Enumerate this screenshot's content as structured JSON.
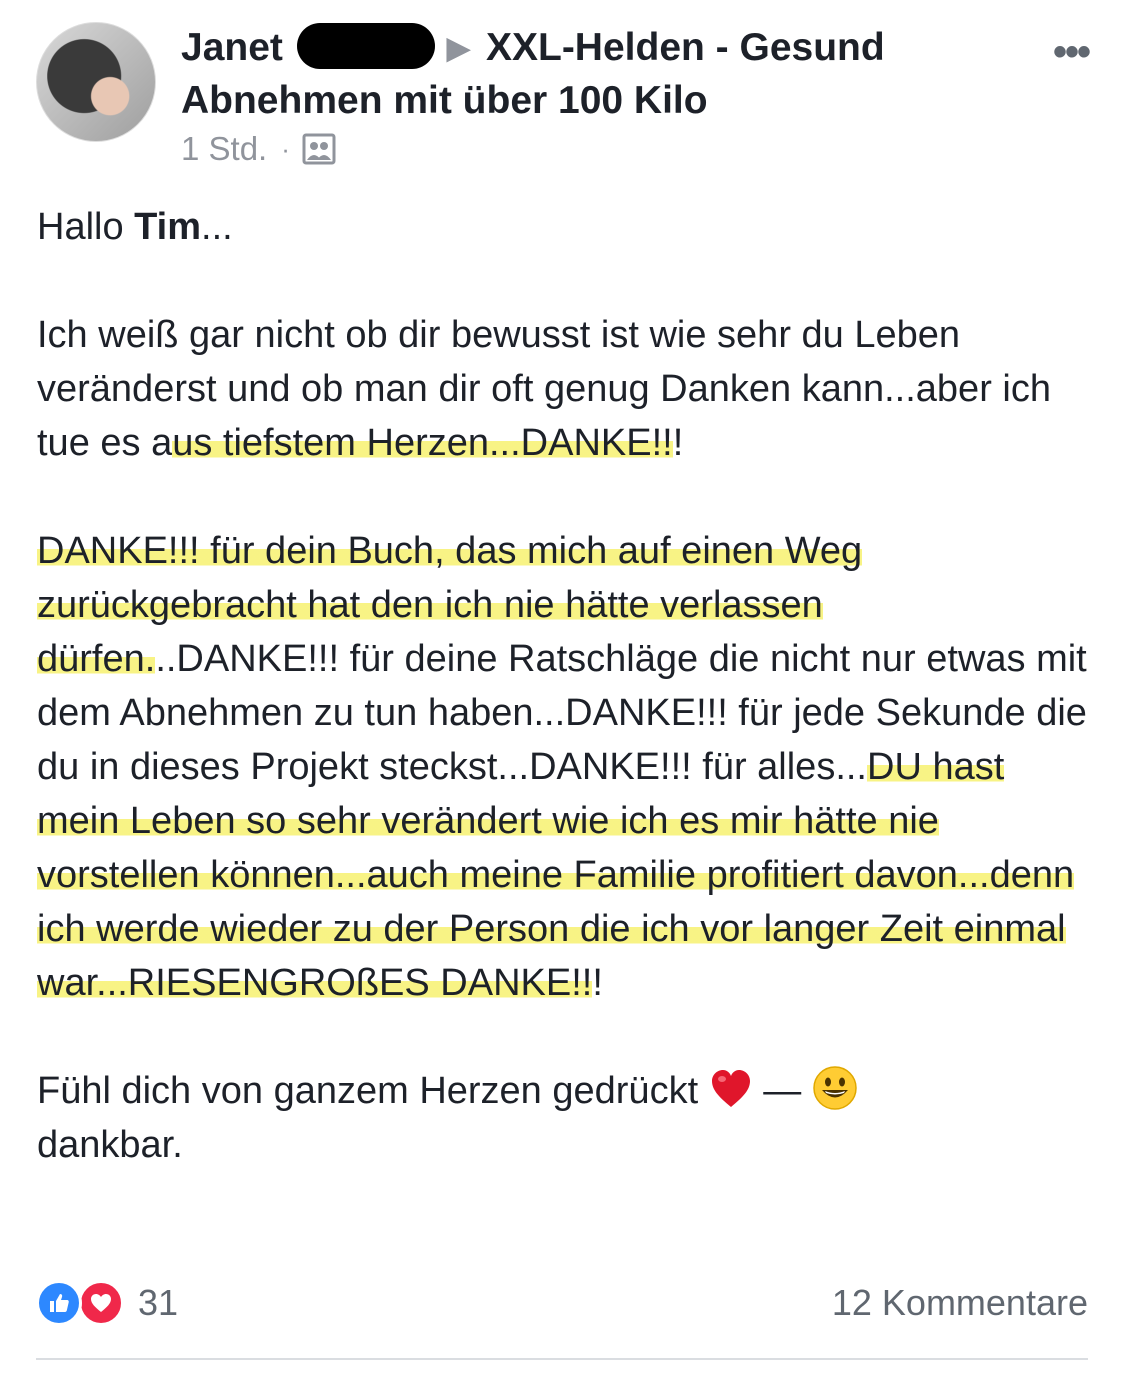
{
  "post": {
    "author": "Janet",
    "group": "XXL-Helden - Gesund Abnehmen mit über 100 Kilo",
    "time": "1 Std.",
    "dot": "·",
    "more": "•••",
    "greeting_prefix": "Hallo ",
    "greeting_name": "Tim",
    "greeting_suffix": "...",
    "p1_a": "Ich weiß gar nicht ob dir bewusst ist wie sehr du Leben veränderst und ob man dir oft genug Danken kann...aber ich tue es a",
    "p1_hl": "us tiefstem Herzen...DANKE!!",
    "p1_b": "!",
    "p2_hl1": "DANKE!!! für dein Buch, das mich auf einen Weg zurückgebracht hat den ich nie hätte verlassen dürfen.",
    "p2_a": "..DANKE!!! für deine Ratschläge die nicht nur etwas mit dem Abnehmen zu tun haben...DANKE!!! für jede Sekunde die du in dieses Projekt steckst...DANKE!!! für alles...",
    "p2_hl2": "DU hast mein Leben so sehr verändert wie ich es mir hätte nie vorstellen können...auch meine Familie profitiert davon...denn ich werde wieder zu der Person die ich vor langer Zeit einmal war...RIESENGROßES DANKE!!",
    "p2_b": "!",
    "p3_a": "Fühl dich von ganzem Herzen gedrückt ",
    "p3_dash": " — ",
    "p3_b": "dankbar."
  },
  "footer": {
    "reaction_count": "31",
    "comments": "12 Kommentare"
  },
  "colors": {
    "like": "#2d88ff",
    "love": "#f0284a",
    "highlight": "#f7f278",
    "meta_gray": "#90949c"
  },
  "icons": [
    "group-icon",
    "heart-emoji-icon",
    "smiley-emoji-icon",
    "like-reaction-icon",
    "love-reaction-icon",
    "more-icon"
  ]
}
